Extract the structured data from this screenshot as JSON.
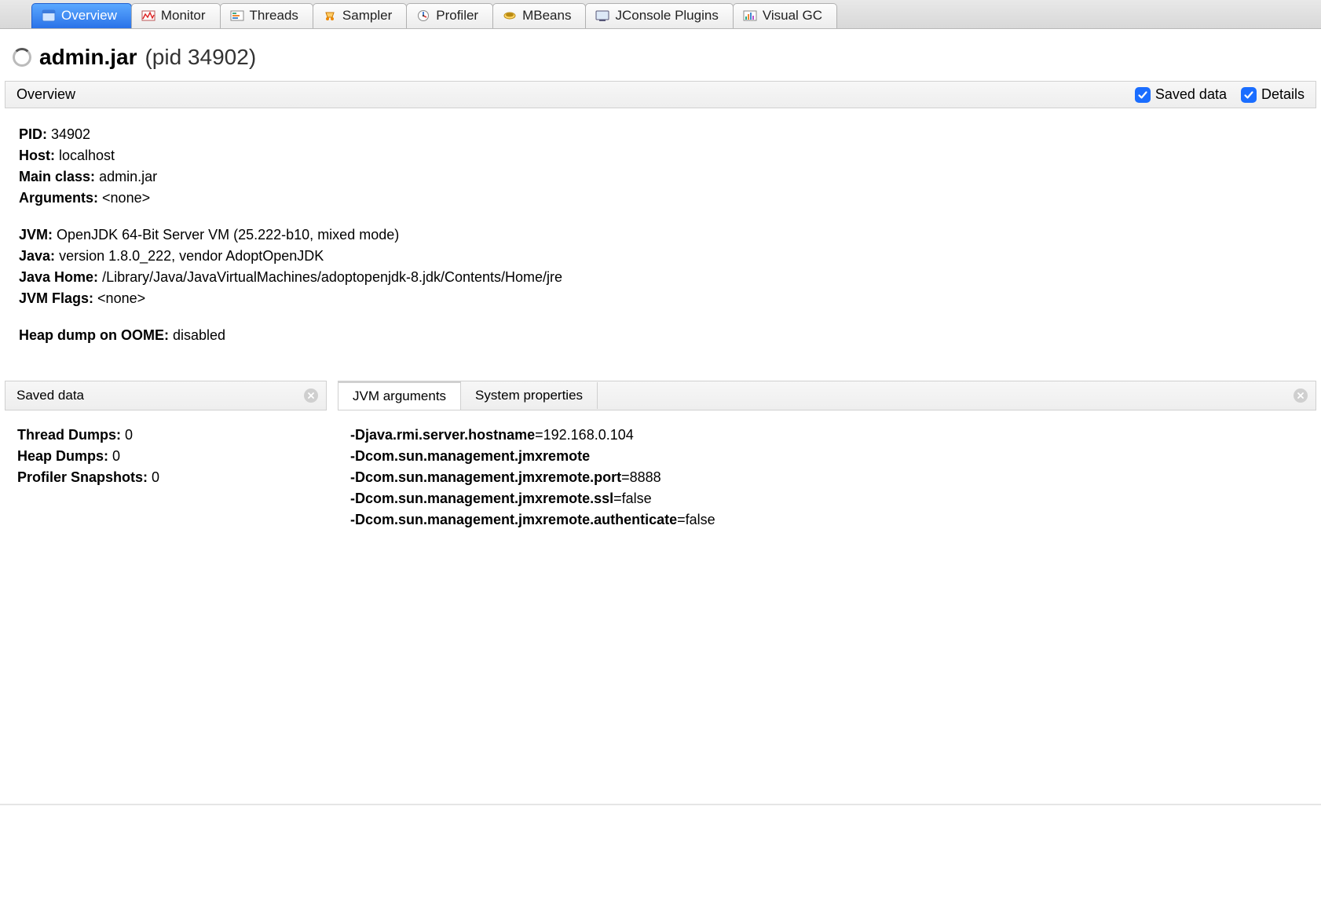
{
  "tabs": [
    {
      "label": "Overview",
      "icon": "overview-icon",
      "active": true
    },
    {
      "label": "Monitor",
      "icon": "monitor-icon",
      "active": false
    },
    {
      "label": "Threads",
      "icon": "threads-icon",
      "active": false
    },
    {
      "label": "Sampler",
      "icon": "sampler-icon",
      "active": false
    },
    {
      "label": "Profiler",
      "icon": "profiler-icon",
      "active": false
    },
    {
      "label": "MBeans",
      "icon": "mbeans-icon",
      "active": false
    },
    {
      "label": "JConsole Plugins",
      "icon": "jconsole-icon",
      "active": false
    },
    {
      "label": "Visual GC",
      "icon": "visualgc-icon",
      "active": false
    }
  ],
  "title": {
    "name": "admin.jar",
    "pid_label": "(pid 34902)"
  },
  "section": {
    "heading": "Overview",
    "saved_data_label": "Saved data",
    "details_label": "Details",
    "saved_data_checked": true,
    "details_checked": true
  },
  "overview": {
    "pid_label": "PID:",
    "pid": "34902",
    "host_label": "Host:",
    "host": "localhost",
    "mainclass_label": "Main class:",
    "mainclass": "admin.jar",
    "args_label": "Arguments:",
    "args": "<none>",
    "jvm_label": "JVM:",
    "jvm": "OpenJDK 64-Bit Server VM (25.222-b10, mixed mode)",
    "java_label": "Java:",
    "java": "version 1.8.0_222, vendor AdoptOpenJDK",
    "javahome_label": "Java Home:",
    "javahome": "/Library/Java/JavaVirtualMachines/adoptopenjdk-8.jdk/Contents/Home/jre",
    "jvmflags_label": "JVM Flags:",
    "jvmflags": "<none>",
    "heapdump_label": "Heap dump on OOME:",
    "heapdump": "disabled"
  },
  "saved_panel": {
    "heading": "Saved data",
    "thread_label": "Thread Dumps:",
    "thread": "0",
    "heap_label": "Heap Dumps:",
    "heap": "0",
    "prof_label": "Profiler Snapshots:",
    "prof": "0"
  },
  "args_panel": {
    "tab_jvm": "JVM arguments",
    "tab_sys": "System properties",
    "args": [
      {
        "key": "-Djava.rmi.server.hostname",
        "val": "=192.168.0.104"
      },
      {
        "key": "-Dcom.sun.management.jmxremote",
        "val": ""
      },
      {
        "key": "-Dcom.sun.management.jmxremote.port",
        "val": "=8888"
      },
      {
        "key": "-Dcom.sun.management.jmxremote.ssl",
        "val": "=false"
      },
      {
        "key": "-Dcom.sun.management.jmxremote.authenticate",
        "val": "=false"
      }
    ]
  }
}
